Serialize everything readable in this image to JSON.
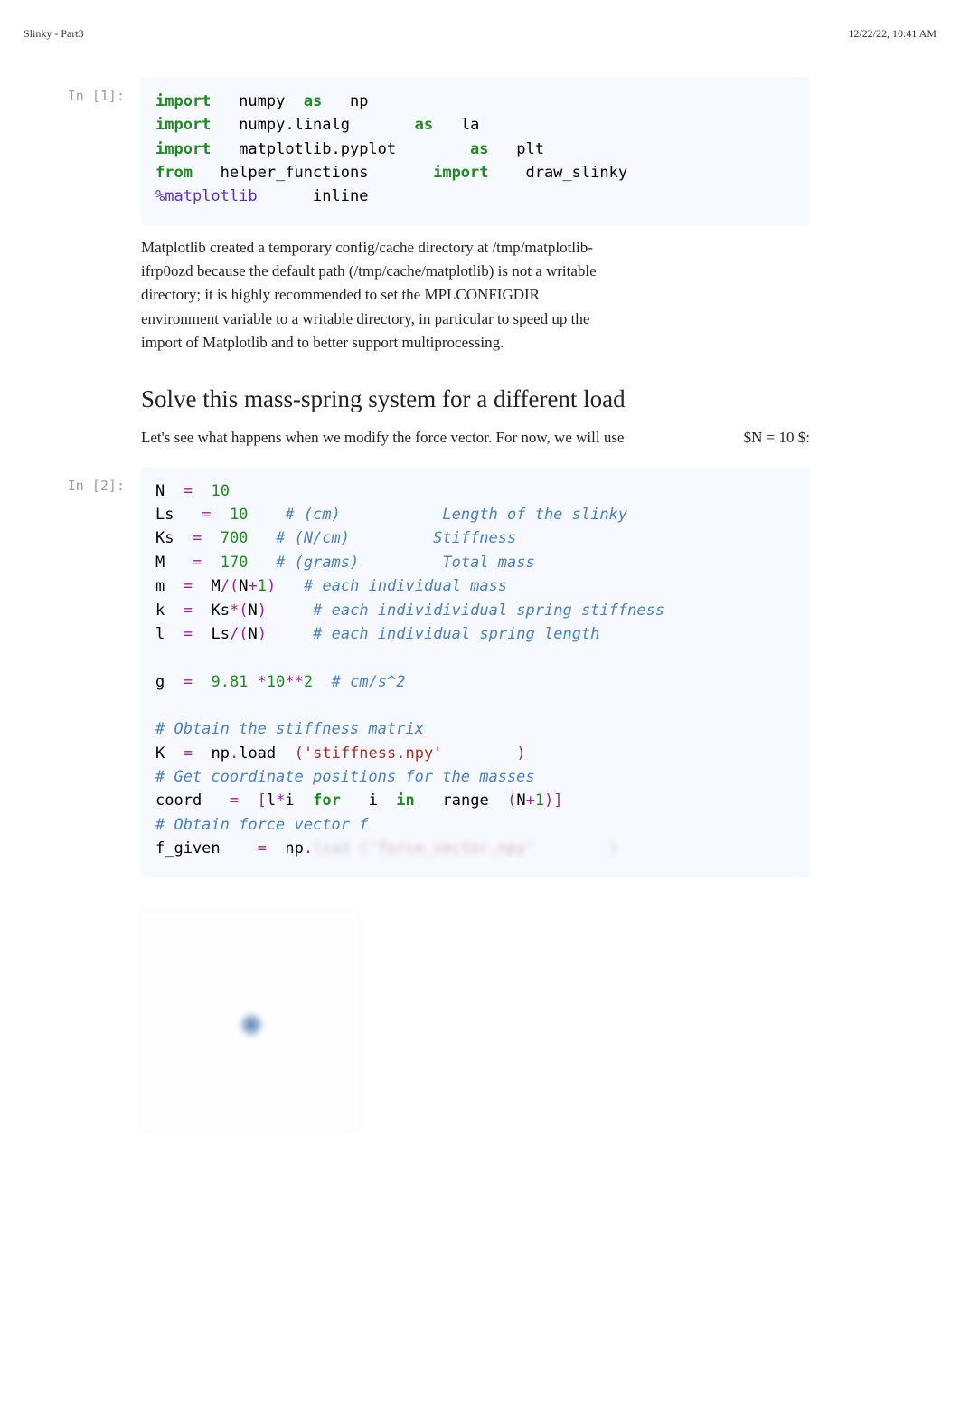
{
  "header": {
    "left": "Slinky - Part3",
    "right": "12/22/22, 10:41 AM"
  },
  "cells": {
    "c1": {
      "prompt": "In [1]:",
      "code": {
        "l1": {
          "kw1": "import",
          "mod": "numpy",
          "kw2": "as",
          "alias": "np"
        },
        "l2": {
          "kw1": "import",
          "mod": "numpy.linalg",
          "kw2": "as",
          "alias": "la"
        },
        "l3": {
          "kw1": "import",
          "mod": "matplotlib.pyplot",
          "kw2": "as",
          "alias": "plt"
        },
        "l4": {
          "kw1": "from",
          "mod": "helper_functions",
          "kw2": "import",
          "name": "draw_slinky"
        },
        "l5": {
          "magic": "%",
          "mname": "matplotlib",
          "arg": "inline"
        }
      },
      "output": "Matplotlib created a temporary config/cache directory at /tmp/matplotlib-ifrp0ozd because the default path (/tmp/cache/matplotlib) is not a writable directory; it is highly recommended to set the MPLCONFIGDIR environment variable to a writable directory, in particular to speed up the import of Matplotlib and to better support multiprocessing."
    },
    "md1": {
      "title": "Solve this mass-spring system for a different load",
      "text": "Let's see what happens when we modify the force vector. For now, we will use",
      "math": "$N = 10 $:"
    },
    "c2": {
      "prompt": "In [2]:",
      "v": {
        "N": "N",
        "eq": "=",
        "ten": "10",
        "Ls": "Ls",
        "Ls_c": "# (cm)           Length of the slinky",
        "Ks": "Ks",
        "n700": "700",
        "Ks_c": "# (N/cm)         Stiffness",
        "M": "M",
        "n170": "170",
        "M_c": "# (grams)         Total mass",
        "m": "m",
        "div": "/",
        "plus": "+",
        "one": "1",
        "m_c": "# each individual mass",
        "k": "k",
        "star": "*",
        "k_c": "# each individividual spring stiffness",
        "l": "l",
        "l_c": "# each individual spring length",
        "g": "g",
        "n981": "9.81",
        "n10": "10",
        "starstar": "**",
        "two": "2",
        "g_c": "# cm/s^2",
        "c_stiff": "# Obtain the stiffness matrix",
        "K": "K",
        "np": "np",
        "dot": ".",
        "load": "load",
        "str_stiff": "'stiffness.npy'",
        "c_coord": "# Get coordinate positions for the masses",
        "coord": "coord",
        "lbr": "[",
        "rbr": "]",
        "for": "for",
        "i": "i",
        "in": "in",
        "range": "range",
        "c_force": "# Obtain force vector f",
        "fgiven": "f_given",
        "blurA": "load",
        "blurB": "('force_vector.npy'",
        "blurC": ")"
      }
    }
  }
}
